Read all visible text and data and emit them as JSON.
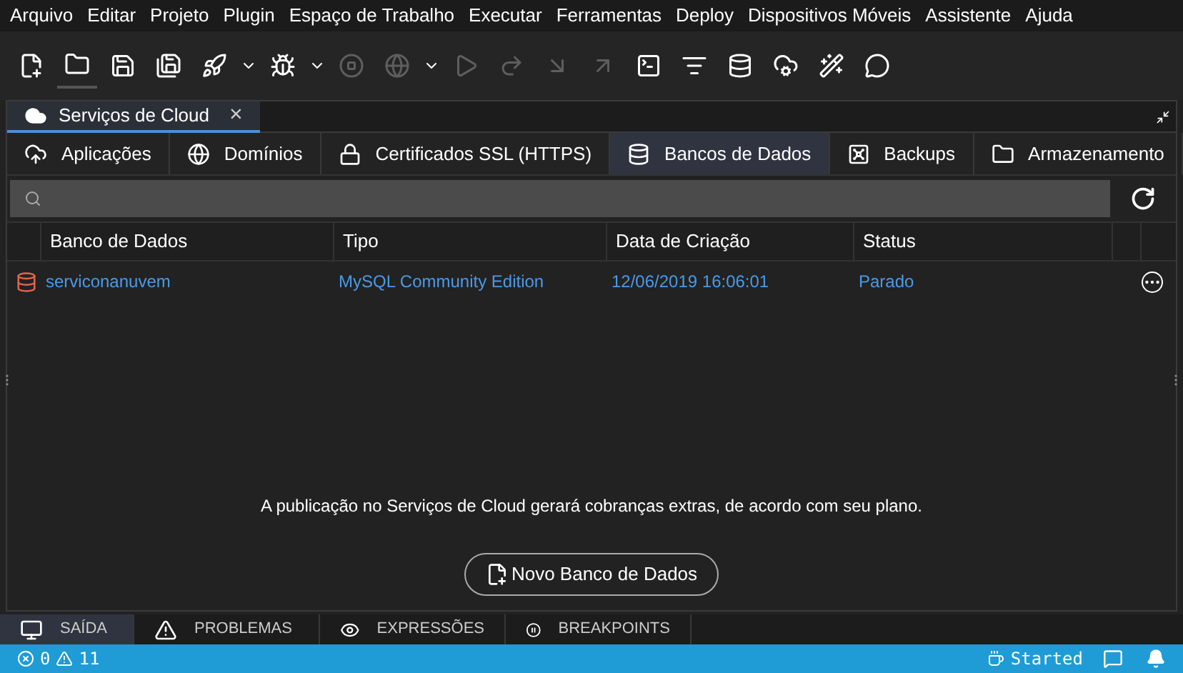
{
  "menu": [
    "Arquivo",
    "Editar",
    "Projeto",
    "Plugin",
    "Espaço de Trabalho",
    "Executar",
    "Ferramentas",
    "Deploy",
    "Dispositivos Móveis",
    "Assistente",
    "Ajuda"
  ],
  "toolbar": [
    {
      "kind": "new-file",
      "disabled": false,
      "selected": false
    },
    {
      "kind": "folder",
      "disabled": false,
      "selected": true
    },
    {
      "kind": "save",
      "disabled": false,
      "selected": false
    },
    {
      "kind": "save-all",
      "disabled": false,
      "selected": false
    },
    {
      "kind": "rocket",
      "disabled": false,
      "selected": false
    },
    {
      "kind": "caret",
      "disabled": false,
      "selected": false
    },
    {
      "kind": "bug",
      "disabled": false,
      "selected": false
    },
    {
      "kind": "caret",
      "disabled": false,
      "selected": false
    },
    {
      "kind": "stop",
      "disabled": true,
      "selected": false
    },
    {
      "kind": "globe",
      "disabled": true,
      "selected": false
    },
    {
      "kind": "caret",
      "disabled": false,
      "selected": false
    },
    {
      "kind": "play",
      "disabled": true,
      "selected": false
    },
    {
      "kind": "step-over",
      "disabled": true,
      "selected": false
    },
    {
      "kind": "step-into",
      "disabled": true,
      "selected": false
    },
    {
      "kind": "step-out",
      "disabled": true,
      "selected": false
    },
    {
      "kind": "terminal",
      "disabled": false,
      "selected": false
    },
    {
      "kind": "search-list",
      "disabled": false,
      "selected": false
    },
    {
      "kind": "database",
      "disabled": false,
      "selected": false
    },
    {
      "kind": "cloud",
      "disabled": false,
      "selected": false
    },
    {
      "kind": "wand",
      "disabled": false,
      "selected": false
    },
    {
      "kind": "chat",
      "disabled": false,
      "selected": false
    }
  ],
  "panel_tab": {
    "title": "Serviços de Cloud",
    "close": "×"
  },
  "tabs": [
    {
      "label": "Aplicações",
      "kind": "cloud-upload",
      "selected": false
    },
    {
      "label": "Domínios",
      "kind": "globe",
      "selected": false
    },
    {
      "label": "Certificados SSL (HTTPS)",
      "kind": "lock",
      "selected": false
    },
    {
      "label": "Bancos de Dados",
      "kind": "database",
      "selected": true
    },
    {
      "label": "Backups",
      "kind": "safe",
      "selected": false
    },
    {
      "label": "Armazenamento",
      "kind": "folder",
      "selected": false
    }
  ],
  "table": {
    "columns": [
      "Banco de Dados",
      "Tipo",
      "Data de Criação",
      "Status"
    ],
    "rows": [
      {
        "name": "serviconanuvem",
        "type": "MySQL Community Edition",
        "created": "12/06/2019 16:06:01",
        "status": "Parado"
      }
    ]
  },
  "notice": "A publicação no Serviços de Cloud gerará cobranças extras, de acordo com seu plano.",
  "new_button": "Novo Banco de Dados",
  "bottom_tabs": [
    {
      "label": "SAÍDA",
      "kind": "monitor",
      "selected": true
    },
    {
      "label": "PROBLEMAS",
      "kind": "warning",
      "selected": false
    },
    {
      "label": "EXPRESSÕES",
      "kind": "eye",
      "selected": false
    },
    {
      "label": "BREAKPOINTS",
      "kind": "pause",
      "selected": false
    }
  ],
  "status_bar": {
    "errors": "0",
    "warnings": "11",
    "server": "Started"
  }
}
